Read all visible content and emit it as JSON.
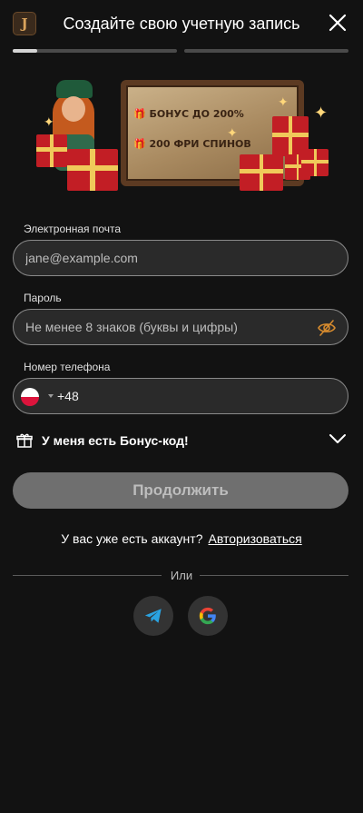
{
  "header": {
    "logo_letter": "J",
    "title": "Создайте свою учетную запись"
  },
  "progress": {
    "steps": 2,
    "current_step": 1,
    "current_step_fill": 0.15
  },
  "banner": {
    "line1": "БОНУС ДО 200%",
    "line2": "200 ФРИ СПИНОВ"
  },
  "form": {
    "email": {
      "label": "Электронная почта",
      "placeholder": "jane@example.com"
    },
    "password": {
      "label": "Пароль",
      "placeholder": "Не менее 8 знаков (буквы и цифры)"
    },
    "phone": {
      "label": "Номер телефона",
      "country_flag": "poland-flag-icon",
      "code": "+48"
    }
  },
  "bonus": {
    "label": "У меня есть Бонус-код!"
  },
  "continue_label": "Продолжить",
  "account": {
    "text": "У вас уже есть аккаунт?",
    "link": "Авторизоваться"
  },
  "or_label": "Или",
  "social": [
    "telegram-icon",
    "google-icon"
  ],
  "colors": {
    "background": "#121212",
    "field_bg": "#2a2a2a",
    "button_disabled": "#6f6f6f",
    "eye_icon": "#d58a2e",
    "telegram": "#2aa3e1"
  }
}
